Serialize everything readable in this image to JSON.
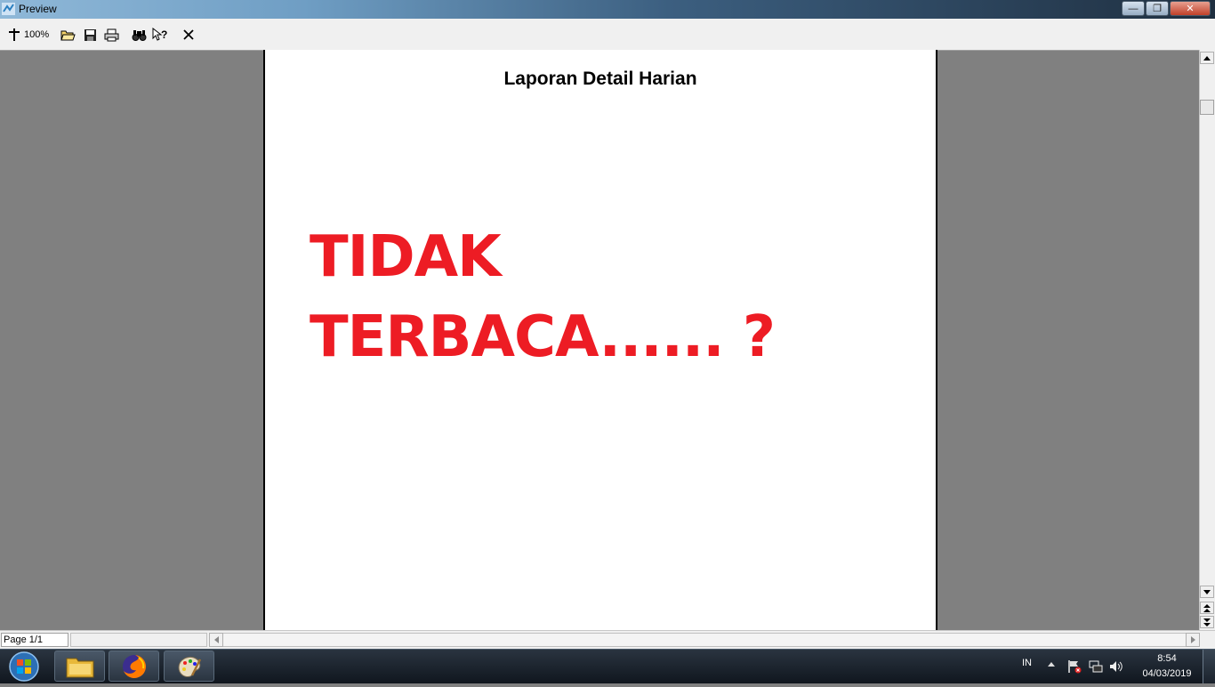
{
  "window": {
    "title": "Preview",
    "controls": {
      "minimize": "—",
      "maximize": "❐",
      "close": "✕"
    }
  },
  "toolbar": {
    "zoom_label": "100%",
    "buttons": [
      "zoom-icon",
      "open-icon",
      "save-icon",
      "print-icon",
      "find-icon",
      "help-icon",
      "close-icon"
    ]
  },
  "report": {
    "title": "Laporan Detail Harian",
    "line1": "TIDAK",
    "line2": "TERBACA...... ?",
    "accent_color": "#ed1c24"
  },
  "status": {
    "page": "Page 1/1"
  },
  "taskbar": {
    "apps": [
      "file-explorer-icon",
      "firefox-icon",
      "paint-icon"
    ],
    "language": "IN",
    "time": "8:54",
    "date": "04/03/2019"
  }
}
